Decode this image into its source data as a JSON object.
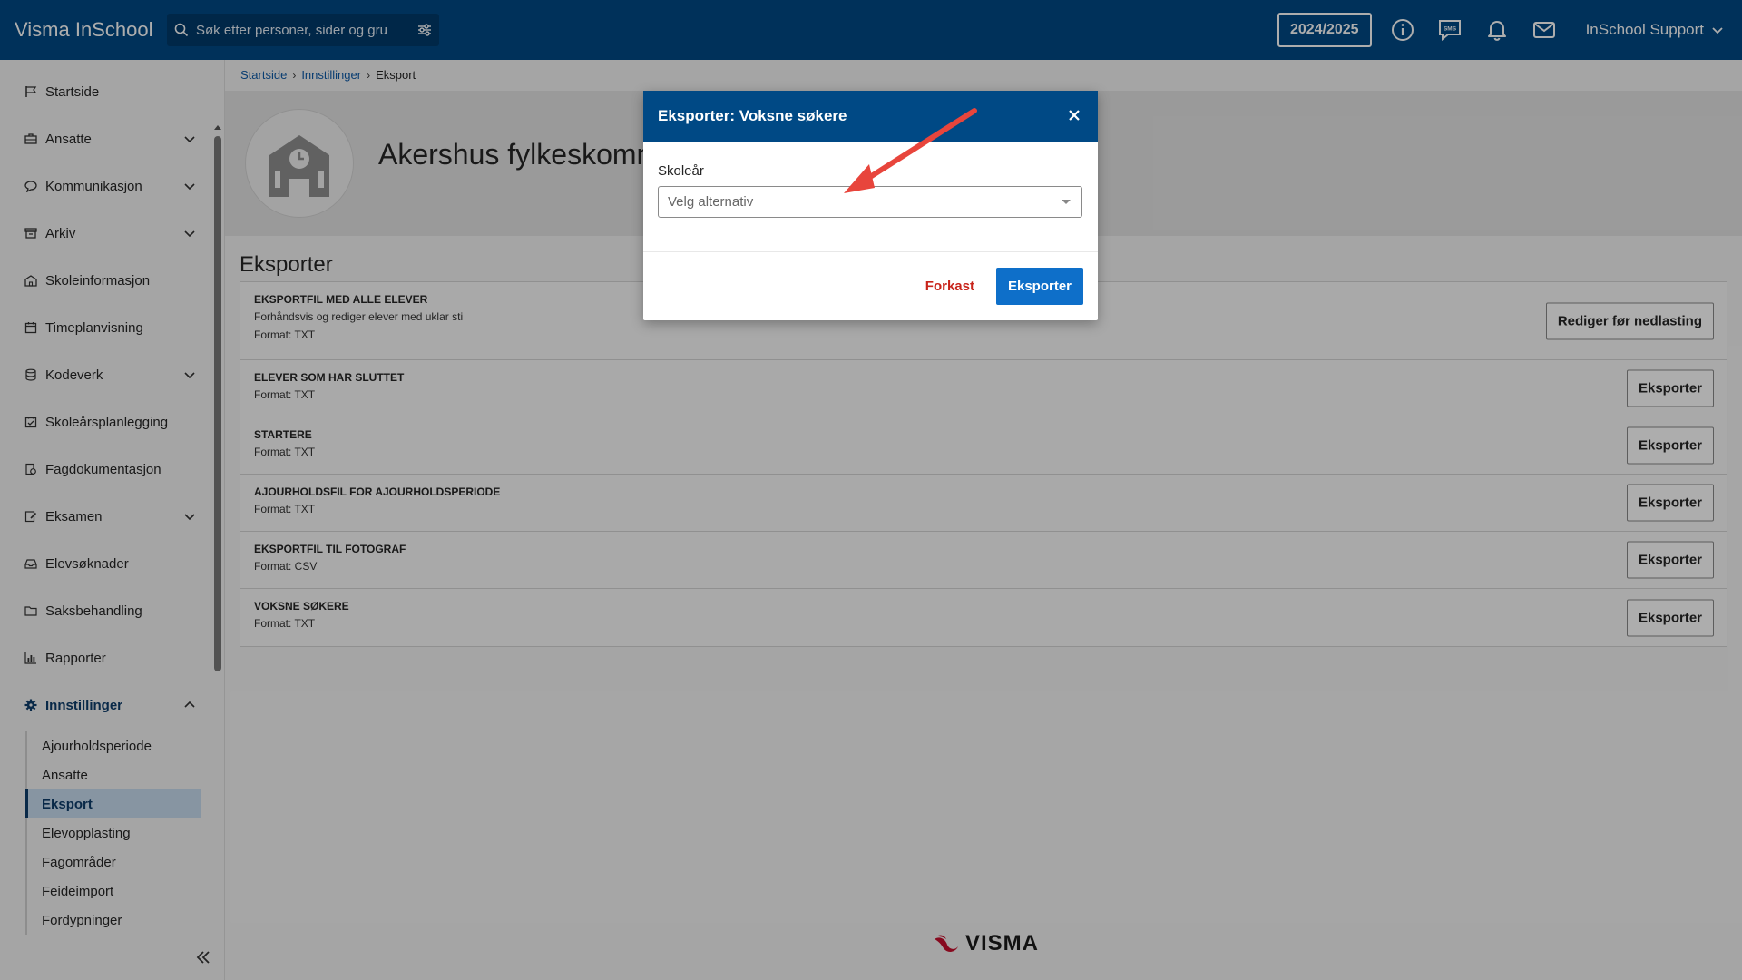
{
  "app": {
    "title": "Visma InSchool"
  },
  "search": {
    "placeholder": "Søk etter personer, sider og gru"
  },
  "topbar": {
    "school_year": "2024/2025",
    "user": "InSchool Support"
  },
  "sidebar": {
    "items": [
      {
        "label": "Startside",
        "icon": "flag-icon",
        "expandable": false
      },
      {
        "label": "Ansatte",
        "icon": "briefcase-icon",
        "expandable": true
      },
      {
        "label": "Kommunikasjon",
        "icon": "chat-bubble-icon",
        "expandable": true
      },
      {
        "label": "Arkiv",
        "icon": "archive-icon",
        "expandable": true
      },
      {
        "label": "Skoleinformasjon",
        "icon": "school-building-icon",
        "expandable": false
      },
      {
        "label": "Timeplanvisning",
        "icon": "calendar-icon",
        "expandable": false
      },
      {
        "label": "Kodeverk",
        "icon": "database-icon",
        "expandable": true
      },
      {
        "label": "Skoleårsplanlegging",
        "icon": "calendar-check-icon",
        "expandable": false
      },
      {
        "label": "Fagdokumentasjon",
        "icon": "link-icon",
        "expandable": false
      },
      {
        "label": "Eksamen",
        "icon": "exam-edit-icon",
        "expandable": true
      },
      {
        "label": "Elevsøknader",
        "icon": "inbox-icon",
        "expandable": false
      },
      {
        "label": "Saksbehandling",
        "icon": "folder-icon",
        "expandable": false
      },
      {
        "label": "Rapporter",
        "icon": "bar-chart-icon",
        "expandable": false
      },
      {
        "label": "Innstillinger",
        "icon": "gear-icon",
        "expandable": true,
        "active": true
      }
    ],
    "subitems": [
      {
        "label": "Ajourholdsperiode"
      },
      {
        "label": "Ansatte"
      },
      {
        "label": "Eksport",
        "active": true
      },
      {
        "label": "Elevopplasting"
      },
      {
        "label": "Fagområder"
      },
      {
        "label": "Feideimport"
      },
      {
        "label": "Fordypninger"
      }
    ]
  },
  "breadcrumb": {
    "home": "Startside",
    "settings": "Innstillinger",
    "current": "Eksport"
  },
  "header": {
    "org_name": "Akershus fylkeskommune"
  },
  "main": {
    "section_title": "Eksporter",
    "rows": [
      {
        "title": "EKSPORTFIL MED ALLE ELEVER",
        "description": "Forhåndsvis og rediger elever med uklar sti",
        "format": "Format: TXT",
        "button": "Rediger før nedlasting"
      },
      {
        "title": "ELEVER SOM HAR SLUTTET",
        "description": "",
        "format": "Format: TXT",
        "button": "Eksporter"
      },
      {
        "title": "STARTERE",
        "description": "",
        "format": "Format: TXT",
        "button": "Eksporter"
      },
      {
        "title": "AJOURHOLDSFIL FOR AJOURHOLDSPERIODE",
        "description": "",
        "format": "Format: TXT",
        "button": "Eksporter"
      },
      {
        "title": "EKSPORTFIL TIL FOTOGRAF",
        "description": "",
        "format": "Format: CSV",
        "button": "Eksporter"
      },
      {
        "title": "VOKSNE SØKERE",
        "description": "",
        "format": "Format: TXT",
        "button": "Eksporter"
      }
    ]
  },
  "footer": {
    "logo_text": "VISMA"
  },
  "modal": {
    "title": "Eksporter: Voksne søkere",
    "field_label": "Skoleår",
    "select_placeholder": "Velg alternativ",
    "cancel_label": "Forkast",
    "submit_label": "Eksporter"
  },
  "colors": {
    "brand": "#004985",
    "primary_button": "#0e6fc9",
    "danger_link": "#c8241b",
    "annotation_arrow": "#e8453c"
  }
}
